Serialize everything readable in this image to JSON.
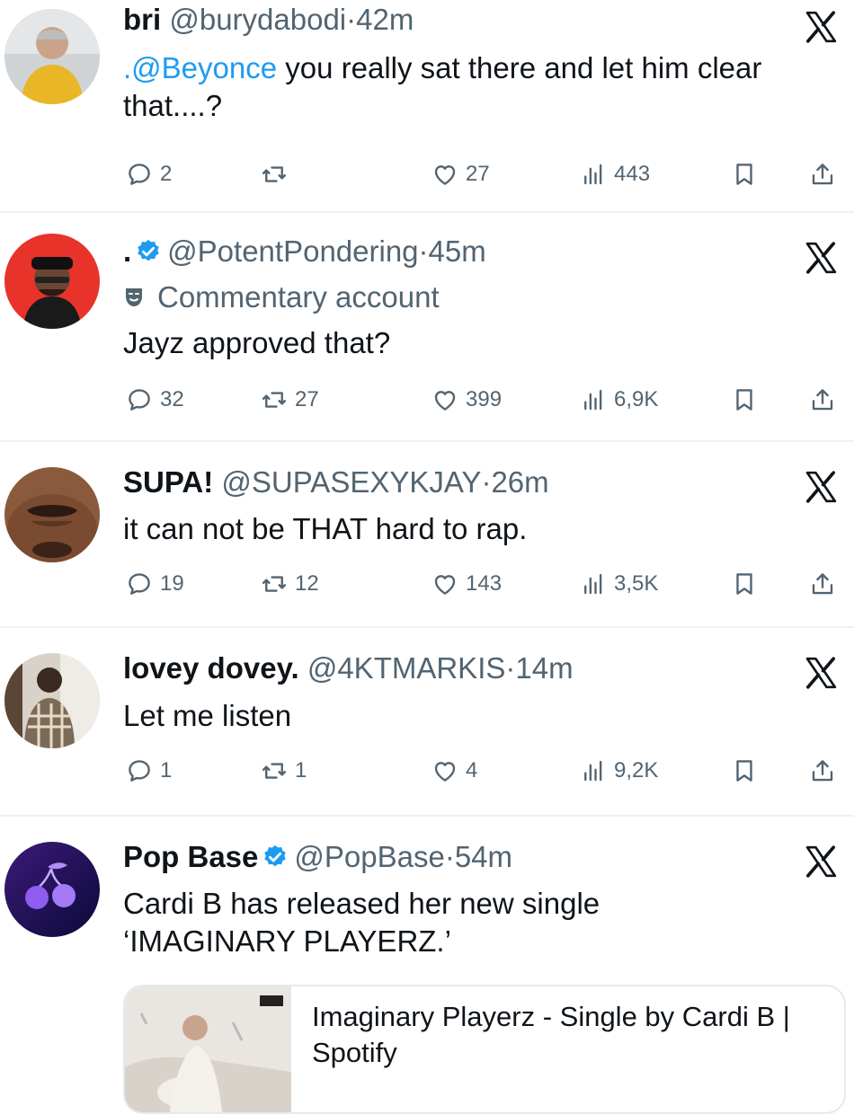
{
  "colors": {
    "accent": "#1d9bf0",
    "muted": "#536471",
    "text": "#0f1419",
    "divider": "#eef0f2"
  },
  "tweets": [
    {
      "name": "bri",
      "handle": "@burydabodi",
      "dot": "·",
      "time": "42m",
      "verified": false,
      "mention": ".@Beyonce",
      "text": " you really sat there and let him clear that....?",
      "replies": "2",
      "retweets": "",
      "likes": "27",
      "views": "443"
    },
    {
      "name": ".",
      "handle": "@PotentPondering",
      "dot": "·",
      "time": "45m",
      "verified": true,
      "commentary": "Commentary account",
      "text": "Jayz approved that?",
      "replies": "32",
      "retweets": "27",
      "likes": "399",
      "views": "6,9K"
    },
    {
      "name": "SUPA!",
      "handle": "@SUPASEXYKJAY",
      "dot": "·",
      "time": "26m",
      "verified": false,
      "text": "it can not be THAT hard to rap.",
      "replies": "19",
      "retweets": "12",
      "likes": "143",
      "views": "3,5K"
    },
    {
      "name": "lovey dovey.",
      "handle": "@4KTMARKIS",
      "dot": "·",
      "time": "14m",
      "verified": false,
      "text": "Let me listen",
      "replies": "1",
      "retweets": "1",
      "likes": "4",
      "views": "9,2K"
    },
    {
      "name": "Pop Base",
      "handle": "@PopBase",
      "dot": "·",
      "time": "54m",
      "verified": true,
      "text": "Cardi B has released her new single ‘IMAGINARY PLAYERZ.’",
      "card_title": "Imaginary Playerz - Single by Cardi B | Spotify"
    }
  ],
  "icons": {
    "reply": "reply-icon",
    "retweet": "retweet-icon",
    "like": "heart-icon",
    "views": "views-chart-icon",
    "bookmark": "bookmark-icon",
    "share": "share-icon",
    "x": "x-logo-icon",
    "verified": "verified-badge-icon"
  }
}
